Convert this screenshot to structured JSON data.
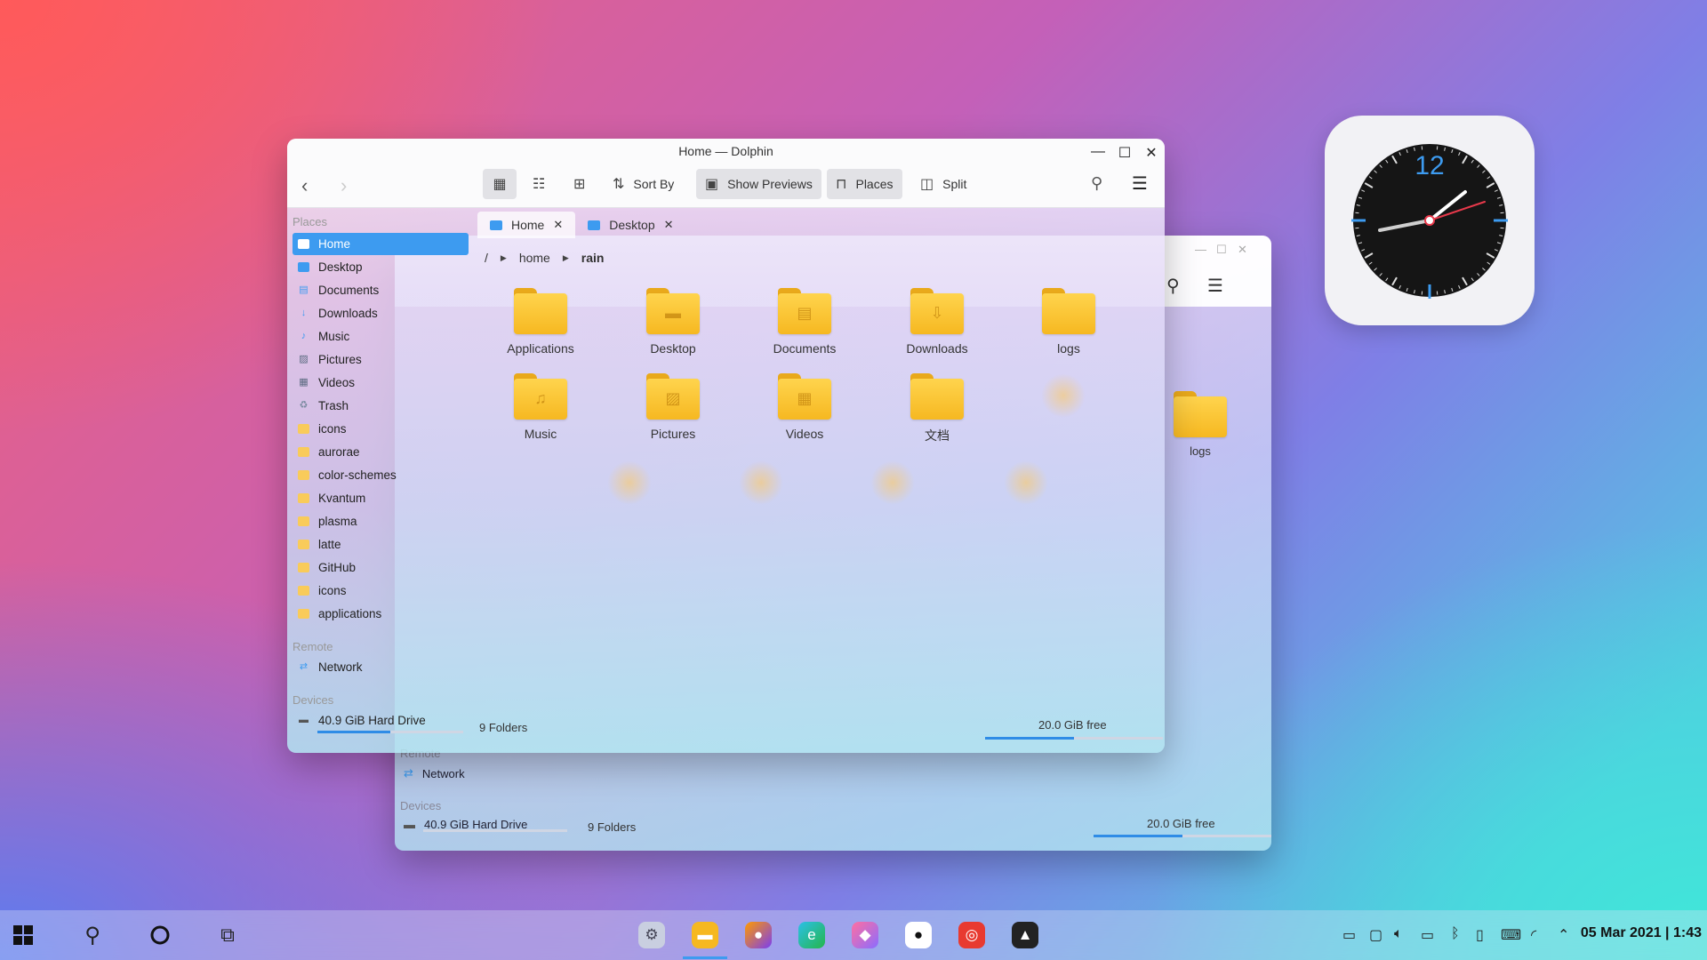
{
  "front_window": {
    "title": "Home — Dolphin",
    "toolbar": {
      "sort_by": "Sort By",
      "show_previews": "Show Previews",
      "places": "Places",
      "split": "Split"
    },
    "sidebar": {
      "places_header": "Places",
      "places": [
        "Home",
        "Desktop",
        "Documents",
        "Downloads",
        "Music",
        "Pictures",
        "Videos",
        "Trash",
        "icons",
        "aurorae",
        "color-schemes",
        "Kvantum",
        "plasma",
        "latte",
        "GitHub",
        "icons",
        "applications"
      ],
      "remote_header": "Remote",
      "network": "Network",
      "devices_header": "Devices",
      "drive": "40.9 GiB Hard Drive"
    },
    "tabs": [
      {
        "label": "Home"
      },
      {
        "label": "Desktop"
      }
    ],
    "breadcrumb": {
      "root": "/",
      "home": "home",
      "current": "rain"
    },
    "folders": [
      "Applications",
      "Desktop",
      "Documents",
      "Downloads",
      "logs",
      "Music",
      "Pictures",
      "Videos",
      "文档"
    ],
    "status": {
      "count": "9 Folders",
      "free": "20.0 GiB free"
    }
  },
  "back_window": {
    "folder": "logs",
    "remote_header": "Remote",
    "network": "Network",
    "devices_header": "Devices",
    "drive": "40.9 GiB Hard Drive",
    "count": "9 Folders",
    "free": "20.0 GiB free"
  },
  "clock_widget": {
    "twelve": "12"
  },
  "taskbar": {
    "datetime": "05 Mar 2021 | 1:43"
  },
  "colors": {
    "accent": "#3d9bf0",
    "folder": "#f6b821"
  }
}
